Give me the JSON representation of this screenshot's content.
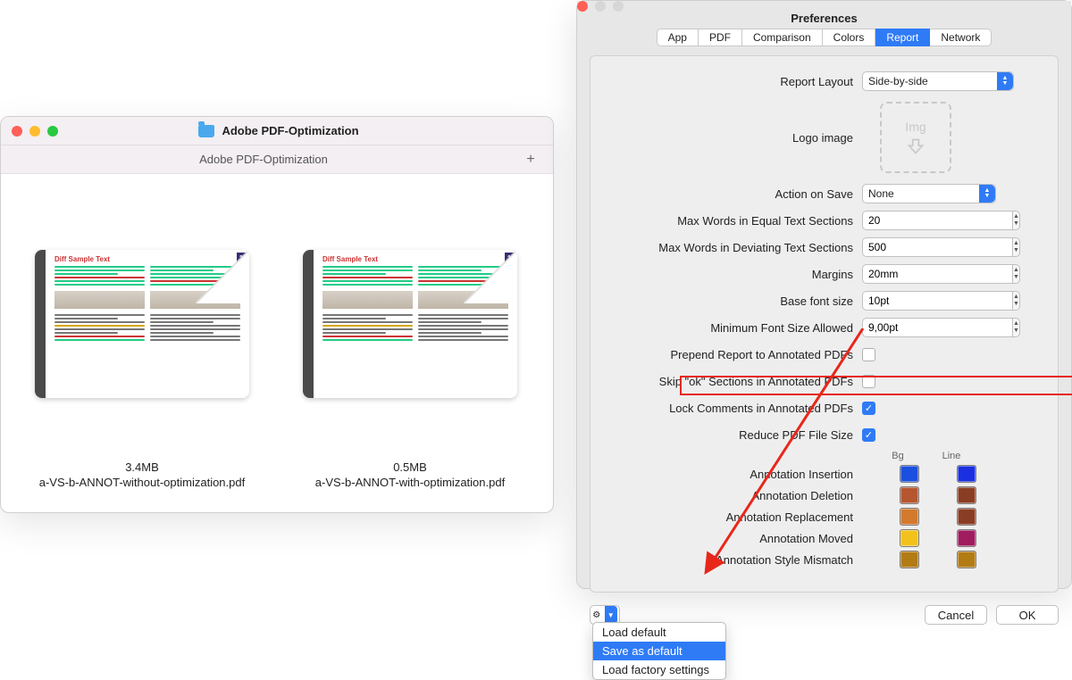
{
  "finder": {
    "title": "Adobe PDF-Optimization",
    "subtitle": "Adobe PDF-Optimization",
    "plus": "+",
    "files": [
      {
        "size": "3.4MB",
        "name": "a-VS-b-ANNOT-without-optimization.pdf"
      },
      {
        "size": "0.5MB",
        "name": "a-VS-b-ANNOT-with-optimization.pdf"
      }
    ],
    "thumb_title": "Diff Sample Text",
    "thumb_pagenum": "1"
  },
  "prefs": {
    "title": "Preferences",
    "tabs": [
      "App",
      "PDF",
      "Comparison",
      "Colors",
      "Report",
      "Network"
    ],
    "active_tab": "Report",
    "labels": {
      "report_layout": "Report Layout",
      "logo_image": "Logo image",
      "action_on_save": "Action on Save",
      "max_words_equal": "Max Words in Equal Text Sections",
      "max_words_dev": "Max Words in Deviating Text Sections",
      "margins": "Margins",
      "base_font": "Base font size",
      "min_font": "Minimum Font Size Allowed",
      "prepend": "Prepend Report to Annotated PDFs",
      "skip_ok": "Skip \"ok\" Sections in Annotated PDFs",
      "lock_comments": "Lock Comments in Annotated PDFs",
      "reduce_size": "Reduce PDF File Size",
      "bg": "Bg",
      "line": "Line",
      "annot_insert": "Annotation Insertion",
      "annot_delete": "Annotation Deletion",
      "annot_replace": "Annotation Replacement",
      "annot_moved": "Annotation Moved",
      "annot_style": "Annotation Style Mismatch"
    },
    "values": {
      "report_layout": "Side-by-side",
      "logo_placeholder": "Img",
      "action_on_save": "None",
      "max_words_equal": "20",
      "max_words_dev": "500",
      "margins": "20mm",
      "base_font": "10pt",
      "min_font": "9,00pt",
      "prepend": false,
      "skip_ok": false,
      "lock_comments": true,
      "reduce_size": true
    },
    "colors": {
      "insertion": {
        "bg": "#1a4fe0",
        "line": "#1a2fe0"
      },
      "deletion": {
        "bg": "#b5562e",
        "line": "#8a3d22"
      },
      "replacement": {
        "bg": "#d47a2d",
        "line": "#8a3d22"
      },
      "moved": {
        "bg": "#f2c21b",
        "line": "#9f1c5e"
      },
      "style": {
        "bg": "#b37b14",
        "line": "#b37b14"
      }
    },
    "buttons": {
      "cancel": "Cancel",
      "ok": "OK"
    },
    "menu": {
      "load_default": "Load default",
      "save_as_default": "Save as default",
      "load_factory": "Load factory settings"
    }
  }
}
